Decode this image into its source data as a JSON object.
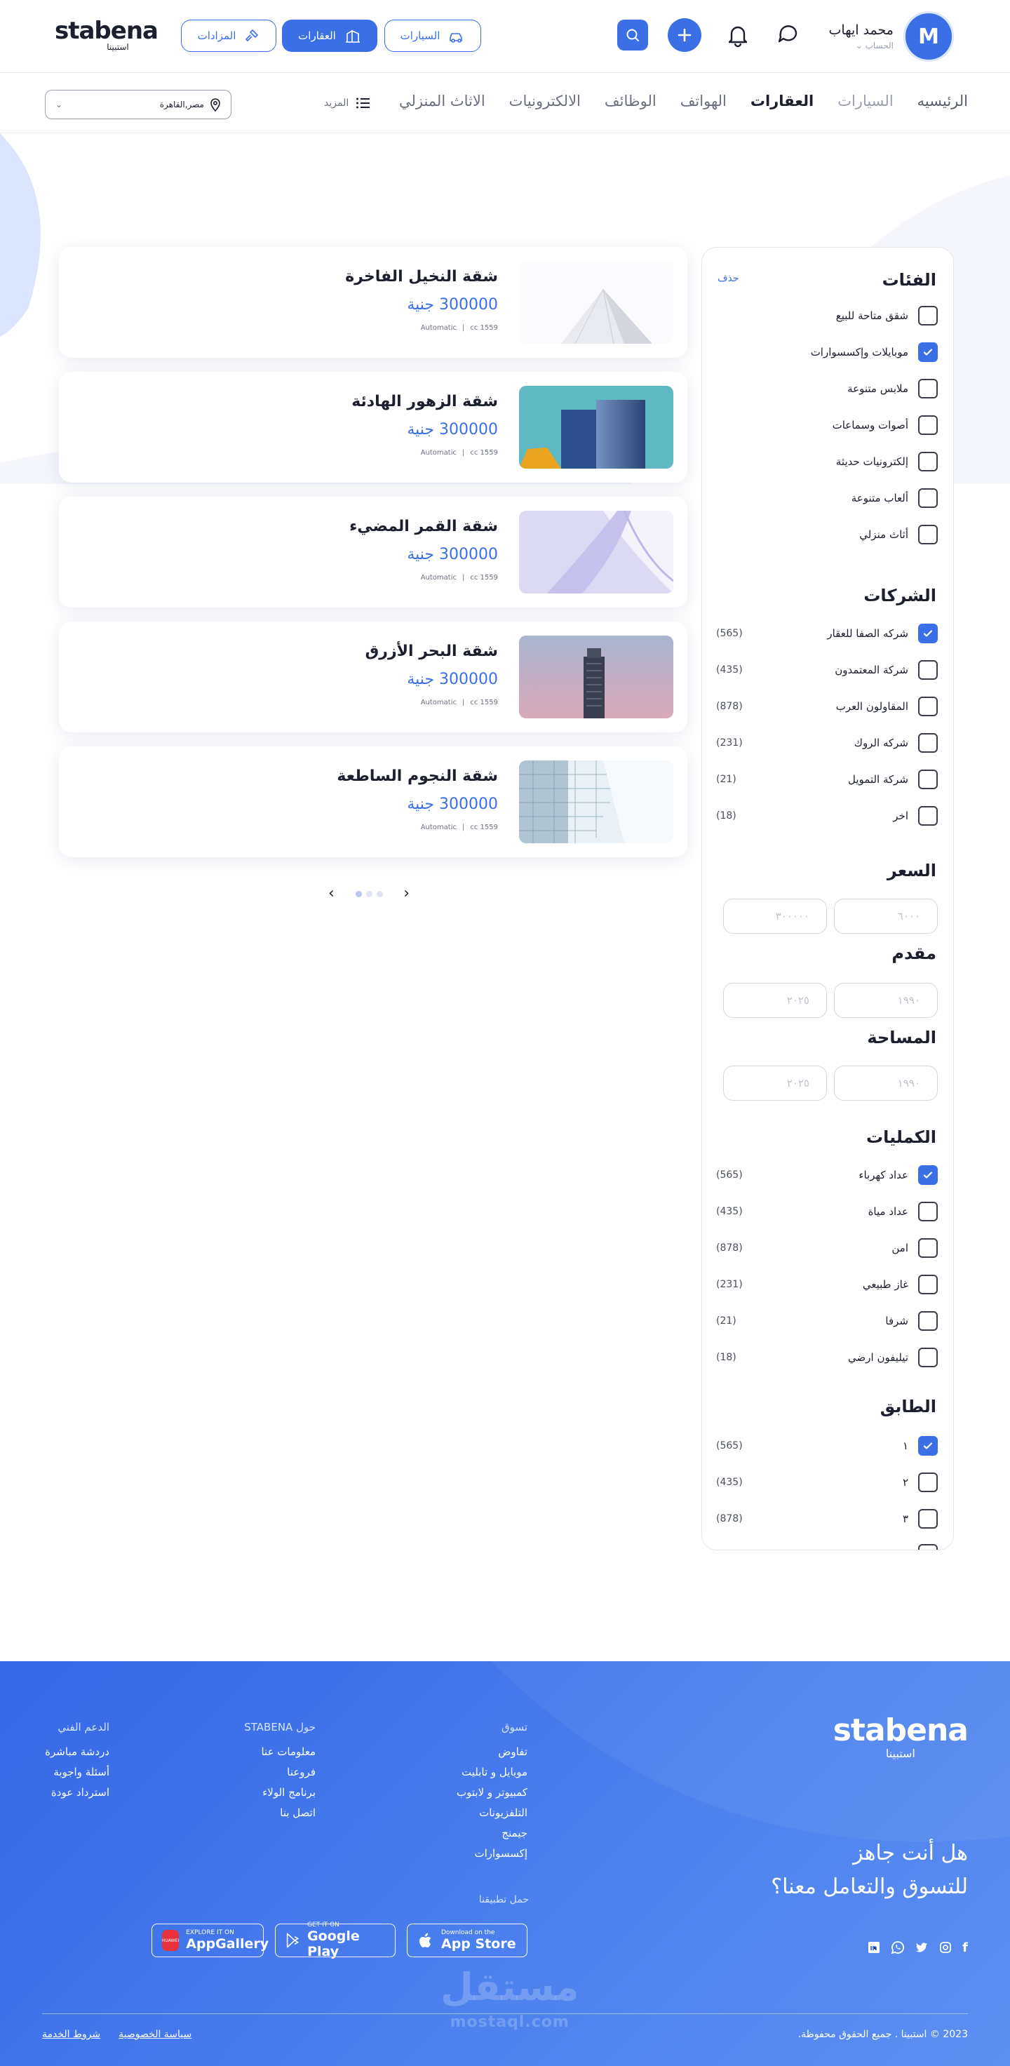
{
  "header": {
    "logo_text": "stabena",
    "logo_sub": "استبينا",
    "user_initial": "M",
    "user_name": "محمد ايهاب",
    "user_sub": "الحساب",
    "pills": [
      "السيارات",
      "العقارات",
      "المزادات"
    ]
  },
  "nav": {
    "items": [
      "الرئيسيه",
      "السيارات",
      "العقارات",
      "الهواتف",
      "الوظائف",
      "الالكترونيات",
      "الاثاث المنزلي"
    ],
    "more": "المزيد",
    "location": "مصر,القاهرة"
  },
  "filters": {
    "categories_title": "الفئات",
    "clear": "حذف",
    "categories": [
      {
        "label": "شقق متاحة للبيع",
        "checked": false
      },
      {
        "label": "موبايلات وإكسسوارات",
        "checked": true
      },
      {
        "label": "ملابس متنوعة",
        "checked": false
      },
      {
        "label": "أصوات وسماعات",
        "checked": false
      },
      {
        "label": "إلكترونيات حديثة",
        "checked": false
      },
      {
        "label": "ألعاب متنوعة",
        "checked": false
      },
      {
        "label": "أثاث منزلي",
        "checked": false
      }
    ],
    "companies_title": "الشركات",
    "companies": [
      {
        "label": "شركه الصفا للعقار",
        "count": "(565)",
        "checked": true
      },
      {
        "label": "شركة المعتمدون",
        "count": "(435)",
        "checked": false
      },
      {
        "label": "المقاولون العرب",
        "count": "(878)",
        "checked": false
      },
      {
        "label": "شركه الروك",
        "count": "(231)",
        "checked": false
      },
      {
        "label": "شركة التمويل",
        "count": "(21)",
        "checked": false
      },
      {
        "label": "اخر",
        "count": "(18)",
        "checked": false
      }
    ],
    "price_title": "السعر",
    "price_from": "٦٠٠٠",
    "price_to": "٣٠٠٠٠٠",
    "down_title": "مقدم",
    "down_from": "١٩٩٠",
    "down_to": "٢٠٢٥",
    "area_title": "المساحة",
    "area_from": "١٩٩٠",
    "area_to": "٢٠٢٥",
    "extras_title": "الكمليات",
    "extras": [
      {
        "label": "عداد كهرباء",
        "count": "(565)",
        "checked": true
      },
      {
        "label": "عداد مياة",
        "count": "(435)",
        "checked": false
      },
      {
        "label": "امن",
        "count": "(878)",
        "checked": false
      },
      {
        "label": "غاز طبيعي",
        "count": "(231)",
        "checked": false
      },
      {
        "label": "شرفا",
        "count": "(21)",
        "checked": false
      },
      {
        "label": "تيليفون ارضي",
        "count": "(18)",
        "checked": false
      }
    ],
    "floor_title": "الطابق",
    "floors": [
      {
        "label": "١",
        "count": "(565)",
        "checked": true
      },
      {
        "label": "٢",
        "count": "(435)",
        "checked": false
      },
      {
        "label": "٣",
        "count": "(878)",
        "checked": false
      }
    ]
  },
  "listings": [
    {
      "title": "شقة النخيل الفاخرة",
      "price": "300000 جنية",
      "cc": "1559 cc",
      "trans": "Automatic",
      "img": "white-tower"
    },
    {
      "title": "شقة الزهور الهادئة",
      "price": "300000 جنية",
      "cc": "1559 cc",
      "trans": "Automatic",
      "img": "blue-towers"
    },
    {
      "title": "شقة القمر المضيء",
      "price": "300000 جنية",
      "cc": "1559 cc",
      "trans": "Automatic",
      "img": "lavender-curve"
    },
    {
      "title": "شقة البحر الأزرق",
      "price": "300000 جنية",
      "cc": "1559 cc",
      "trans": "Automatic",
      "img": "pink-tower"
    },
    {
      "title": "شقة النجوم الساطعة",
      "price": "300000 جنية",
      "cc": "1559 cc",
      "trans": "Automatic",
      "img": "glass-facade"
    }
  ],
  "pager": {
    "pages": 3,
    "current": 1
  },
  "footer": {
    "logo_text": "stabena",
    "logo_sub": "استبينا",
    "cta_line1": "هل أنت جاهز",
    "cta_line2": "للتسوق والتعامل معنا؟",
    "col_shop": {
      "title": "تسوق",
      "links": [
        "تفاوض",
        "موبايل و تابليت",
        "كمبيوتر و لابتوب",
        "التلفزيونات",
        "جيمنج",
        "إكسسوارات"
      ]
    },
    "col_about": {
      "title": "حول STABENA",
      "links": [
        "معلومات عنا",
        "فروعنا",
        "برنامج الولاء",
        "اتصل بنا"
      ]
    },
    "col_support": {
      "title": "الدعم الفني",
      "links": [
        "دردشة مباشرة",
        "أسئلة واجوبة",
        "استرداد عودة"
      ]
    },
    "download_label": "حمل تطبيقنا",
    "stores": [
      {
        "small": "Download on the",
        "big": "App Store"
      },
      {
        "small": "GET IT ON",
        "big": "Google Play"
      },
      {
        "small": "EXPLORE IT ON",
        "big": "AppGallery"
      }
    ],
    "copyright": "2023 © استبينا . جميع الحقوق محفوظة.",
    "legal": [
      "سياسة الخصوصية",
      "شروط الخدمة"
    ],
    "watermark": "مستقل",
    "watermark_sub": "mostaql.com"
  },
  "colors": {
    "accent": "#3b6fe6",
    "footer_bg": "#3567e6"
  }
}
